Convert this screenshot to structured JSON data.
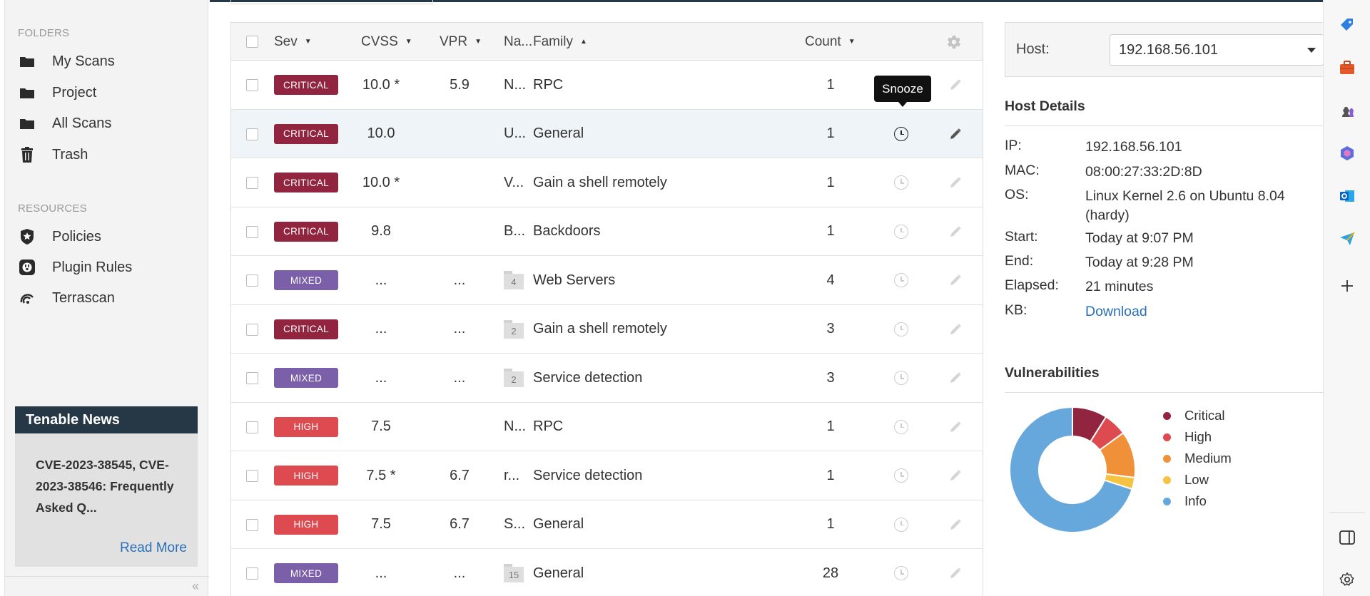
{
  "sidebar": {
    "folders_heading": "FOLDERS",
    "folders": [
      {
        "label": "My Scans",
        "icon": "folder-icon"
      },
      {
        "label": "Project",
        "icon": "folder-icon"
      },
      {
        "label": "All Scans",
        "icon": "folder-icon"
      },
      {
        "label": "Trash",
        "icon": "trash-icon"
      }
    ],
    "resources_heading": "RESOURCES",
    "resources": [
      {
        "label": "Policies",
        "icon": "shield-star-icon"
      },
      {
        "label": "Plugin Rules",
        "icon": "plug-icon"
      },
      {
        "label": "Terrascan",
        "icon": "terrascan-icon"
      }
    ],
    "collapse_label": "«"
  },
  "news": {
    "title": "Tenable News",
    "text": "CVE-2023-38545, CVE-2023-38546: Frequently Asked Q...",
    "read_more": "Read More"
  },
  "table": {
    "columns": {
      "sev": "Sev",
      "cvss": "CVSS",
      "vpr": "VPR",
      "name": "Na...",
      "family": "Family",
      "count": "Count"
    },
    "sort_caret_down": "▼",
    "sort_caret_up": "▲",
    "tooltip": "Snooze",
    "rows": [
      {
        "sev": "CRITICAL",
        "color": "#91243e",
        "cvss": "10.0 *",
        "vpr": "5.9",
        "name": "N...",
        "family": "RPC",
        "count": "1",
        "group": ""
      },
      {
        "sev": "CRITICAL",
        "color": "#91243e",
        "cvss": "10.0",
        "vpr": "",
        "name": "U...",
        "family": "General",
        "count": "1",
        "group": ""
      },
      {
        "sev": "CRITICAL",
        "color": "#91243e",
        "cvss": "10.0 *",
        "vpr": "",
        "name": "V...",
        "family": "Gain a shell remotely",
        "count": "1",
        "group": ""
      },
      {
        "sev": "CRITICAL",
        "color": "#91243e",
        "cvss": "9.8",
        "vpr": "",
        "name": "B...",
        "family": "Backdoors",
        "count": "1",
        "group": ""
      },
      {
        "sev": "MIXED",
        "color": "#7b5fa8",
        "cvss": "...",
        "vpr": "...",
        "name": "",
        "family": "Web Servers",
        "count": "4",
        "group": "4"
      },
      {
        "sev": "CRITICAL",
        "color": "#91243e",
        "cvss": "...",
        "vpr": "...",
        "name": "",
        "family": "Gain a shell remotely",
        "count": "3",
        "group": "2"
      },
      {
        "sev": "MIXED",
        "color": "#7b5fa8",
        "cvss": "...",
        "vpr": "...",
        "name": "",
        "family": "Service detection",
        "count": "3",
        "group": "2"
      },
      {
        "sev": "HIGH",
        "color": "#dd4b50",
        "cvss": "7.5",
        "vpr": "",
        "name": "N...",
        "family": "RPC",
        "count": "1",
        "group": ""
      },
      {
        "sev": "HIGH",
        "color": "#dd4b50",
        "cvss": "7.5 *",
        "vpr": "6.7",
        "name": "r...",
        "family": "Service detection",
        "count": "1",
        "group": ""
      },
      {
        "sev": "HIGH",
        "color": "#dd4b50",
        "cvss": "7.5",
        "vpr": "6.7",
        "name": "S...",
        "family": "General",
        "count": "1",
        "group": ""
      },
      {
        "sev": "MIXED",
        "color": "#7b5fa8",
        "cvss": "...",
        "vpr": "...",
        "name": "",
        "family": "General",
        "count": "28",
        "group": "15"
      }
    ]
  },
  "host": {
    "label": "Host:",
    "selected": "192.168.56.101"
  },
  "details": {
    "title": "Host Details",
    "items": [
      {
        "k": "IP:",
        "v": "192.168.56.101"
      },
      {
        "k": "MAC:",
        "v": "08:00:27:33:2D:8D"
      },
      {
        "k": "OS:",
        "v": "Linux Kernel 2.6 on Ubuntu 8.04 (hardy)"
      },
      {
        "k": "Start:",
        "v": "Today at 9:07 PM"
      },
      {
        "k": "End:",
        "v": "Today at 9:28 PM"
      },
      {
        "k": "Elapsed:",
        "v": "21 minutes"
      },
      {
        "k": "KB:",
        "v": "Download"
      }
    ]
  },
  "vulnerabilities": {
    "title": "Vulnerabilities",
    "legend": [
      {
        "name": "Critical",
        "color": "#91243e",
        "value": 9
      },
      {
        "name": "High",
        "color": "#dd4b50",
        "value": 6
      },
      {
        "name": "Medium",
        "color": "#f0913a",
        "value": 12
      },
      {
        "name": "Low",
        "color": "#f5c342",
        "value": 3
      },
      {
        "name": "Info",
        "color": "#67a8dc",
        "value": 70
      }
    ]
  },
  "browser_strip": {
    "icons": [
      "tag-icon",
      "briefcase-icon",
      "chess-icon",
      "copilot-icon",
      "outlook-icon",
      "send-icon",
      "plus-icon",
      "sidebar-toggle-icon",
      "settings-icon"
    ]
  }
}
